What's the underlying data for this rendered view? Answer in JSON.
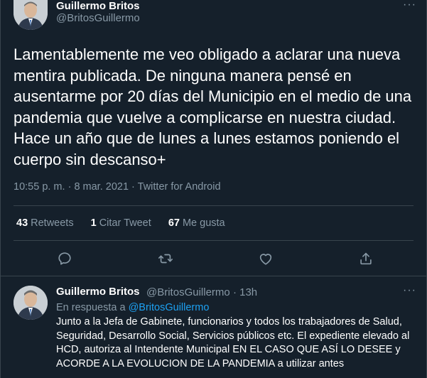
{
  "tweet": {
    "author_name": "Guillermo Britos",
    "author_handle": "@BritosGuillermo",
    "text": "Lamentablemente me veo obligado a aclarar una nueva mentira publicada. De ninguna manera pensé en ausentarme por 20 días del Municipio en el medio de una pandemia que vuelve a complicarse en nuestra ciudad. Hace un año que de lunes a lunes estamos poniendo el cuerpo sin descanso+",
    "time": "10:55 p. m.",
    "date": "8 mar. 2021",
    "source": "Twitter for Android",
    "more_label": "···"
  },
  "stats": {
    "retweets_count": "43",
    "retweets_label": "Retweets",
    "quotes_count": "1",
    "quotes_label": "Citar Tweet",
    "likes_count": "67",
    "likes_label": "Me gusta"
  },
  "actions": {
    "icons": [
      "reply-icon",
      "retweet-icon",
      "like-icon",
      "share-icon"
    ]
  },
  "reply": {
    "author_name": "Guillermo Britos",
    "author_handle": "@BritosGuillermo",
    "time_ago": "13h",
    "in_reply_prefix": "En respuesta a",
    "in_reply_handle": "@BritosGuillermo",
    "text": "Junto a la Jefa de Gabinete, funcionarios y todos los trabajadores de Salud, Seguridad, Desarrollo Social, Servicios públicos etc. El expediente elevado al HCD, autoriza al Intendente Municipal EN EL CASO QUE ASÍ LO DESEE y ACORDE A LA EVOLUCION DE LA PANDEMIA a utilizar antes",
    "more_label": "···"
  },
  "colors": {
    "background": "#15202b",
    "text_secondary": "#8899a6",
    "accent": "#1da1f2",
    "border": "#38444d"
  }
}
